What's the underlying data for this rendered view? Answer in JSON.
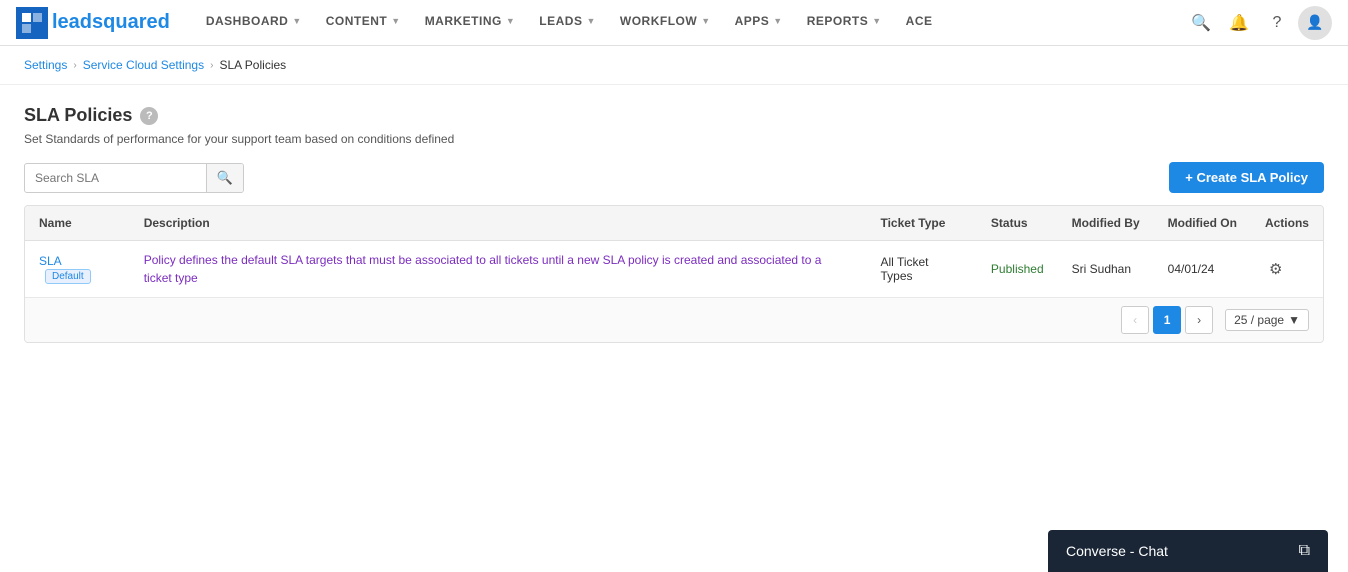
{
  "app": {
    "logo_text_plain": "lead",
    "logo_text_bold": "squared"
  },
  "nav": {
    "items": [
      {
        "id": "dashboard",
        "label": "DASHBOARD",
        "has_caret": true
      },
      {
        "id": "content",
        "label": "CONTENT",
        "has_caret": true
      },
      {
        "id": "marketing",
        "label": "MARKETING",
        "has_caret": true
      },
      {
        "id": "leads",
        "label": "LEADS",
        "has_caret": true
      },
      {
        "id": "workflow",
        "label": "WORKFLOW",
        "has_caret": true
      },
      {
        "id": "apps",
        "label": "APPS",
        "has_caret": true
      },
      {
        "id": "reports",
        "label": "REPORTS",
        "has_caret": true
      },
      {
        "id": "ace",
        "label": "ACE",
        "has_caret": false
      }
    ],
    "icons": {
      "search": "🔍",
      "bell": "🔔",
      "help": "?",
      "user": "👤"
    }
  },
  "breadcrumb": {
    "items": [
      {
        "label": "Settings",
        "link": true
      },
      {
        "label": "Service Cloud Settings",
        "link": true
      },
      {
        "label": "SLA Policies",
        "link": false
      }
    ]
  },
  "page": {
    "title": "SLA Policies",
    "subtitle": "Set Standards of performance for your support team based on conditions defined",
    "help_icon": "?"
  },
  "toolbar": {
    "search_placeholder": "Search SLA",
    "search_icon": "🔍",
    "create_button_label": "+ Create SLA Policy"
  },
  "table": {
    "columns": [
      {
        "id": "name",
        "label": "Name"
      },
      {
        "id": "description",
        "label": "Description"
      },
      {
        "id": "ticket_type",
        "label": "Ticket Type"
      },
      {
        "id": "status",
        "label": "Status"
      },
      {
        "id": "modified_by",
        "label": "Modified By"
      },
      {
        "id": "modified_on",
        "label": "Modified On"
      },
      {
        "id": "actions",
        "label": "Actions"
      }
    ],
    "rows": [
      {
        "name": "SLA",
        "badge": "Default",
        "description": "Policy defines the default SLA targets that must be associated to all tickets until a new SLA policy is created and associated to a ticket type",
        "ticket_type": "All Ticket Types",
        "status": "Published",
        "modified_by": "Sri Sudhan",
        "modified_on": "04/01/24"
      }
    ]
  },
  "pagination": {
    "current_page": "1",
    "per_page": "25 / page",
    "prev_icon": "‹",
    "next_icon": "›"
  },
  "converse_chat": {
    "label": "Converse - Chat",
    "icon": "⧉"
  }
}
